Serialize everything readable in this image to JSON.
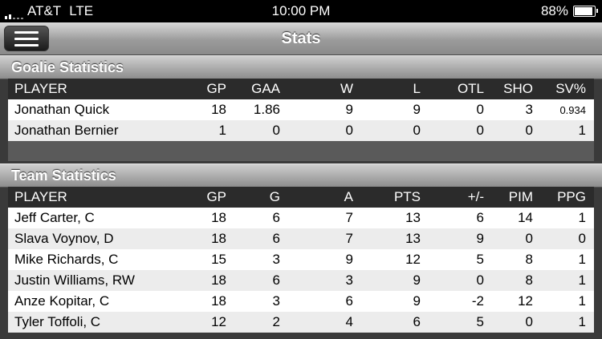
{
  "status": {
    "carrier": "AT&T",
    "network": "LTE",
    "time": "10:00 PM",
    "battery": "88%"
  },
  "nav": {
    "title": "Stats"
  },
  "goalie": {
    "header": "Goalie Statistics",
    "columns": [
      "PLAYER",
      "GP",
      "GAA",
      "W",
      "L",
      "OTL",
      "SHO",
      "SV%"
    ],
    "rows": [
      [
        "Jonathan Quick",
        "18",
        "1.86",
        "9",
        "9",
        "0",
        "3",
        "0.934"
      ],
      [
        "Jonathan Bernier",
        "1",
        "0",
        "0",
        "0",
        "0",
        "0",
        "1"
      ]
    ]
  },
  "team": {
    "header": "Team Statistics",
    "columns": [
      "PLAYER",
      "GP",
      "G",
      "A",
      "PTS",
      "+/-",
      "PIM",
      "PPG"
    ],
    "rows": [
      [
        "Jeff Carter, C",
        "18",
        "6",
        "7",
        "13",
        "6",
        "14",
        "1"
      ],
      [
        "Slava Voynov, D",
        "18",
        "6",
        "7",
        "13",
        "9",
        "0",
        "0"
      ],
      [
        "Mike Richards, C",
        "15",
        "3",
        "9",
        "12",
        "5",
        "8",
        "1"
      ],
      [
        "Justin Williams, RW",
        "18",
        "6",
        "3",
        "9",
        "0",
        "8",
        "1"
      ],
      [
        "Anze Kopitar, C",
        "18",
        "3",
        "6",
        "9",
        "-2",
        "12",
        "1"
      ],
      [
        "Tyler Toffoli, C",
        "12",
        "2",
        "4",
        "6",
        "5",
        "0",
        "1"
      ]
    ]
  }
}
